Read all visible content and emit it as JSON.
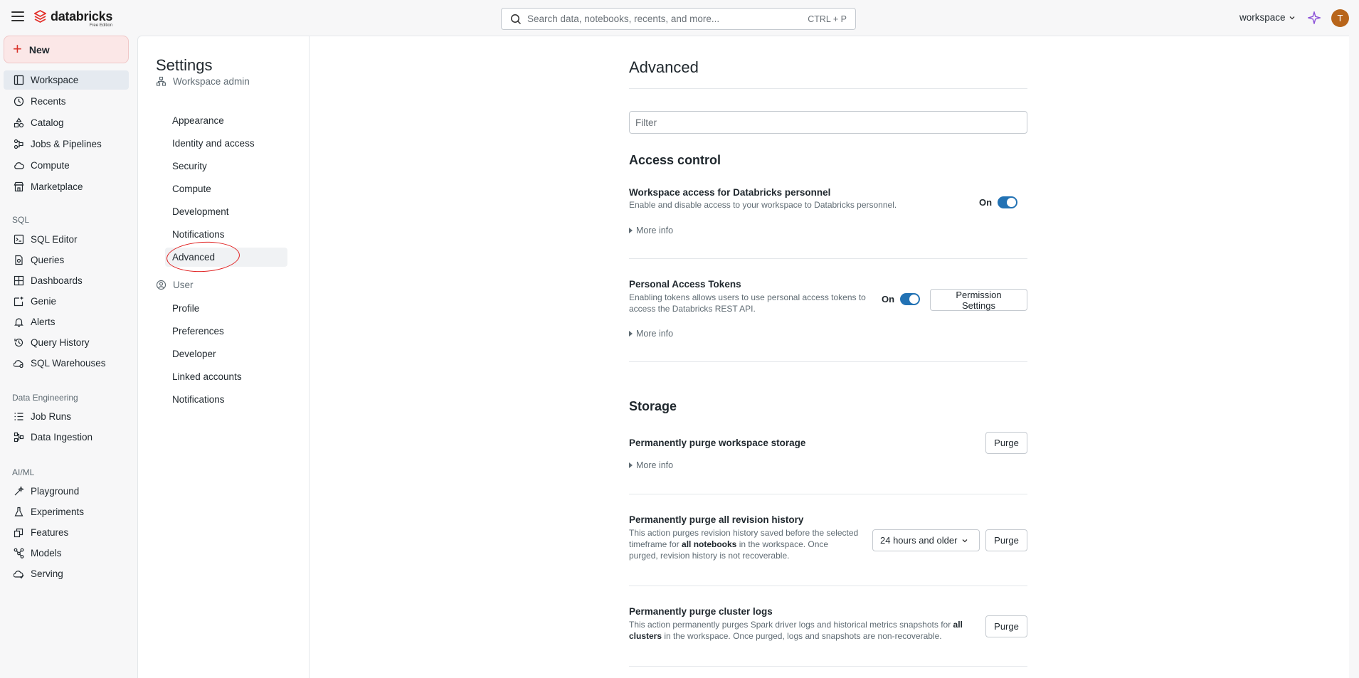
{
  "topbar": {
    "brand_name": "databricks",
    "brand_edition": "Free Edition",
    "search_placeholder": "Search data, notebooks, recents, and more...",
    "search_shortcut": "CTRL + P",
    "workspace_label": "workspace",
    "avatar_initial": "T"
  },
  "leftnav": {
    "new_label": "New",
    "items_main": [
      {
        "label": "Workspace",
        "icon": "workspace-icon"
      },
      {
        "label": "Recents",
        "icon": "clock-icon"
      },
      {
        "label": "Catalog",
        "icon": "catalog-icon"
      },
      {
        "label": "Jobs & Pipelines",
        "icon": "jobs-icon"
      },
      {
        "label": "Compute",
        "icon": "cloud-icon"
      },
      {
        "label": "Marketplace",
        "icon": "store-icon"
      }
    ],
    "sql_section": "SQL",
    "items_sql": [
      {
        "label": "SQL Editor",
        "icon": "sql-editor-icon"
      },
      {
        "label": "Queries",
        "icon": "query-icon"
      },
      {
        "label": "Dashboards",
        "icon": "dashboard-icon"
      },
      {
        "label": "Genie",
        "icon": "genie-icon"
      },
      {
        "label": "Alerts",
        "icon": "bell-icon"
      },
      {
        "label": "Query History",
        "icon": "history-icon"
      },
      {
        "label": "SQL Warehouses",
        "icon": "warehouse-icon"
      }
    ],
    "de_section": "Data Engineering",
    "items_de": [
      {
        "label": "Job Runs",
        "icon": "list-icon"
      },
      {
        "label": "Data Ingestion",
        "icon": "ingestion-icon"
      }
    ],
    "ai_section": "AI/ML",
    "items_ai": [
      {
        "label": "Playground",
        "icon": "playground-icon"
      },
      {
        "label": "Experiments",
        "icon": "flask-icon"
      },
      {
        "label": "Features",
        "icon": "features-icon"
      },
      {
        "label": "Models",
        "icon": "models-icon"
      },
      {
        "label": "Serving",
        "icon": "serving-icon"
      }
    ]
  },
  "settings": {
    "title": "Settings",
    "workspace_admin": "Workspace admin",
    "admin_items": [
      "Appearance",
      "Identity and access",
      "Security",
      "Compute",
      "Development",
      "Notifications",
      "Advanced"
    ],
    "user_group": "User",
    "user_items": [
      "Profile",
      "Preferences",
      "Developer",
      "Linked accounts",
      "Notifications"
    ]
  },
  "content": {
    "title": "Advanced",
    "filter_placeholder": "Filter",
    "access_control": {
      "heading": "Access control",
      "personnel": {
        "title": "Workspace access for Databricks personnel",
        "desc": "Enable and disable access to your workspace to Databricks personnel.",
        "state": "On",
        "more_info": "More info"
      },
      "tokens": {
        "title": "Personal Access Tokens",
        "desc_line1": "Enabling tokens allows users to use personal access tokens to",
        "desc_line2": "access the Databricks REST API.",
        "state": "On",
        "button": "Permission Settings",
        "more_info": "More info"
      }
    },
    "storage": {
      "heading": "Storage",
      "purge_storage": {
        "title": "Permanently purge workspace storage",
        "button": "Purge",
        "more_info": "More info"
      },
      "purge_revision": {
        "title": "Permanently purge all revision history",
        "desc_line1": "This action purges revision history saved before the selected",
        "desc_line2_pre": "timeframe for ",
        "desc_line2_bold": "all notebooks",
        "desc_line2_post": " in the workspace. Once",
        "desc_line3": "purged, revision history is not recoverable.",
        "select_value": "24 hours and older",
        "button": "Purge"
      },
      "purge_logs": {
        "title": "Permanently purge cluster logs",
        "desc_line1_pre": "This action permanently purges Spark driver logs and historical metrics snapshots for ",
        "desc_line1_bold": "all",
        "desc_line2_bold": "clusters",
        "desc_line2_post": " in the workspace. Once purged, logs and snapshots are non-recoverable.",
        "button": "Purge"
      }
    }
  },
  "colors": {
    "accent": "#2272b4",
    "new_button_bg": "#fbe7e7",
    "annotation": "#e02020",
    "avatar": "#b8651a"
  }
}
